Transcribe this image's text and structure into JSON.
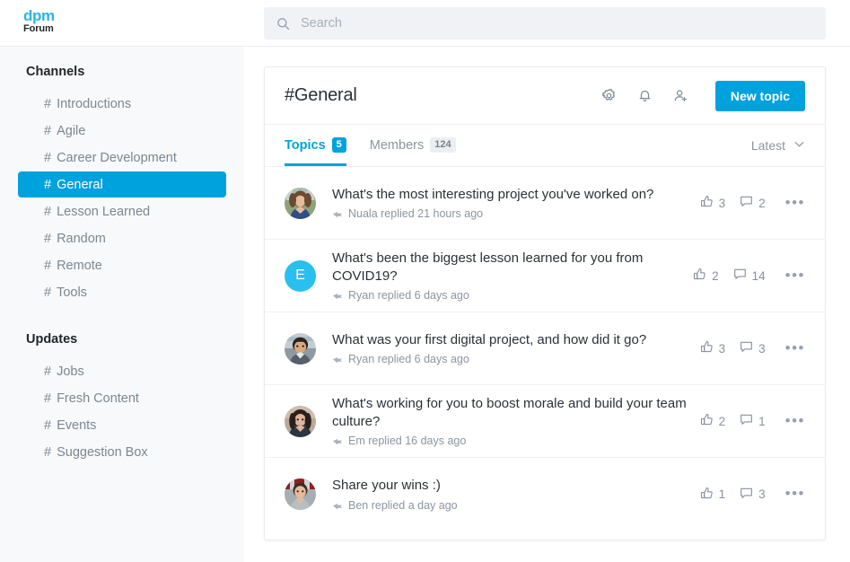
{
  "brand": {
    "logo_primary": "dpm",
    "logo_secondary": "Forum",
    "accent_color": "#00a2dd",
    "logo_color": "#2ab4e8"
  },
  "search": {
    "placeholder": "Search",
    "value": "",
    "icon": "search-icon"
  },
  "sidebar": {
    "sections": [
      {
        "title": "Channels",
        "items": [
          {
            "label": "Introductions",
            "hash": "#",
            "active": false
          },
          {
            "label": "Agile",
            "hash": "#",
            "active": false
          },
          {
            "label": "Career Development",
            "hash": "#",
            "active": false
          },
          {
            "label": "General",
            "hash": "#",
            "active": true
          },
          {
            "label": "Lesson Learned",
            "hash": "#",
            "active": false
          },
          {
            "label": "Random",
            "hash": "#",
            "active": false
          },
          {
            "label": "Remote",
            "hash": "#",
            "active": false
          },
          {
            "label": "Tools",
            "hash": "#",
            "active": false
          }
        ]
      },
      {
        "title": "Updates",
        "items": [
          {
            "label": "Jobs",
            "hash": "#",
            "active": false
          },
          {
            "label": "Fresh Content",
            "hash": "#",
            "active": false
          },
          {
            "label": "Events",
            "hash": "#",
            "active": false
          },
          {
            "label": "Suggestion Box",
            "hash": "#",
            "active": false
          }
        ]
      }
    ]
  },
  "header": {
    "channel_title": "#General",
    "icons": [
      "gear-icon",
      "bell-icon",
      "person-add-icon"
    ],
    "new_topic_label": "New topic"
  },
  "tabs": [
    {
      "label": "Topics",
      "badge": "5",
      "active": true
    },
    {
      "label": "Members",
      "badge": "124",
      "active": false
    }
  ],
  "sort": {
    "label": "Latest",
    "icon": "chevron-down-icon"
  },
  "topics": [
    {
      "title": "What's the most interesting project you've worked on?",
      "meta": "Nuala replied 21 hours ago",
      "likes": "3",
      "comments": "2",
      "avatar_type": "photo",
      "avatar_letter": "",
      "avatar_palette": [
        "#7f9a6d",
        "#3a4a6b",
        "#d6c3a8"
      ]
    },
    {
      "title": "What's been the biggest lesson learned for you from COVID19?",
      "meta": "Ryan replied 6 days ago",
      "likes": "2",
      "comments": "14",
      "avatar_type": "letter",
      "avatar_letter": "E",
      "avatar_palette": [
        "#29c0ed",
        "#29c0ed",
        "#29c0ed"
      ]
    },
    {
      "title": "What was your first digital project, and how did it go?",
      "meta": "Ryan replied 6 days ago",
      "likes": "3",
      "comments": "3",
      "avatar_type": "photo",
      "avatar_letter": "",
      "avatar_palette": [
        "#b6c4cb",
        "#2f2b29",
        "#d8ab86"
      ]
    },
    {
      "title": "What's working for you to boost morale and build your team culture?",
      "meta": "Em replied 16 days ago",
      "likes": "2",
      "comments": "1",
      "avatar_type": "photo",
      "avatar_letter": "",
      "avatar_palette": [
        "#b9a79a",
        "#2a1f1c",
        "#e0b59a"
      ]
    },
    {
      "title": "Share your wins :)",
      "meta": "Ben replied a day ago",
      "likes": "1",
      "comments": "3",
      "avatar_type": "photo",
      "avatar_letter": "",
      "avatar_palette": [
        "#9fa9ae",
        "#8c1b1b",
        "#e3bb9c"
      ]
    }
  ]
}
